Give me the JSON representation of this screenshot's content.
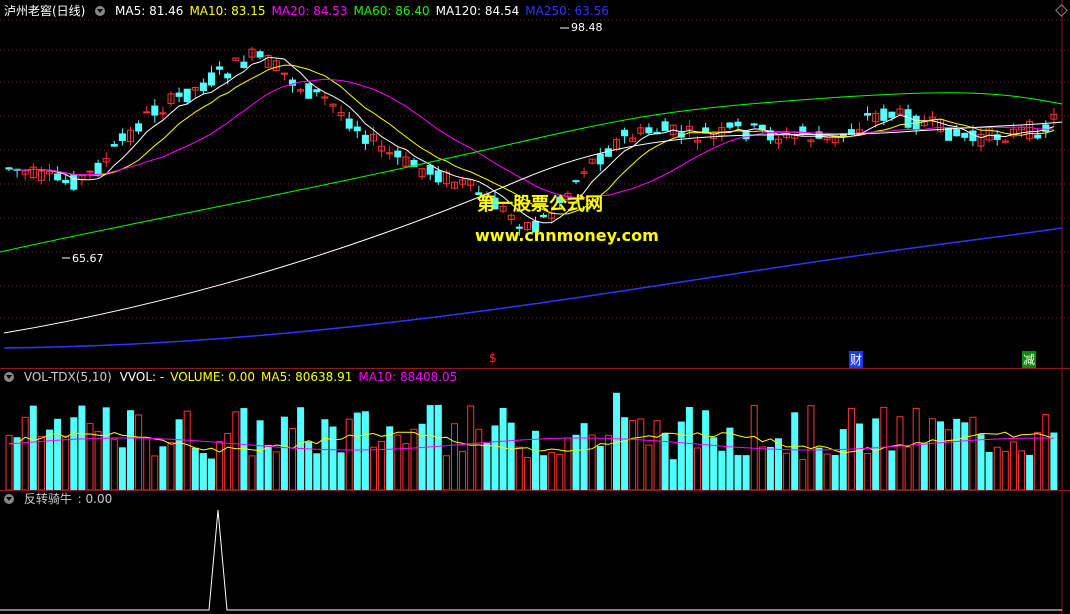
{
  "main": {
    "title": "泸州老窖(日线)",
    "ma": [
      {
        "label": "MA5: 81.46",
        "color": "#ffffff"
      },
      {
        "label": "MA10: 83.15",
        "color": "#ffff00"
      },
      {
        "label": "MA20: 84.53",
        "color": "#ff00ff"
      },
      {
        "label": "MA60: 86.40",
        "color": "#00ff00"
      },
      {
        "label": "MA120: 84.54",
        "color": "#ffffff"
      },
      {
        "label": "MA250: 63.56",
        "color": "#3333ff"
      }
    ],
    "high_label": "98.48",
    "low_label": "65.67",
    "markers": [
      {
        "text": "$",
        "color": "#ff3030"
      },
      {
        "text": "财",
        "color": "#ffffff",
        "bg": "#1a3cff"
      },
      {
        "text": "减",
        "color": "#ffffff",
        "bg": "#0a8a0a"
      }
    ]
  },
  "watermark": {
    "line1": "第一股票公式网",
    "line2": "www.chnmoney.com"
  },
  "volume": {
    "title": "VOL-TDX(5,10)",
    "items": [
      {
        "label": "VVOL: -",
        "color": "#ffffff"
      },
      {
        "label": "VOLUME: 0.00",
        "color": "#ffff00"
      },
      {
        "label": "MA5: 80638.91",
        "color": "#ffff00"
      },
      {
        "label": "MA10: 88408.05",
        "color": "#ff00ff"
      }
    ]
  },
  "indicator": {
    "title": "反转骑牛",
    "value": ": 0.00"
  },
  "colors": {
    "up": "#ff3232",
    "down": "#54ffff",
    "grid": "#8b1a1a"
  }
}
